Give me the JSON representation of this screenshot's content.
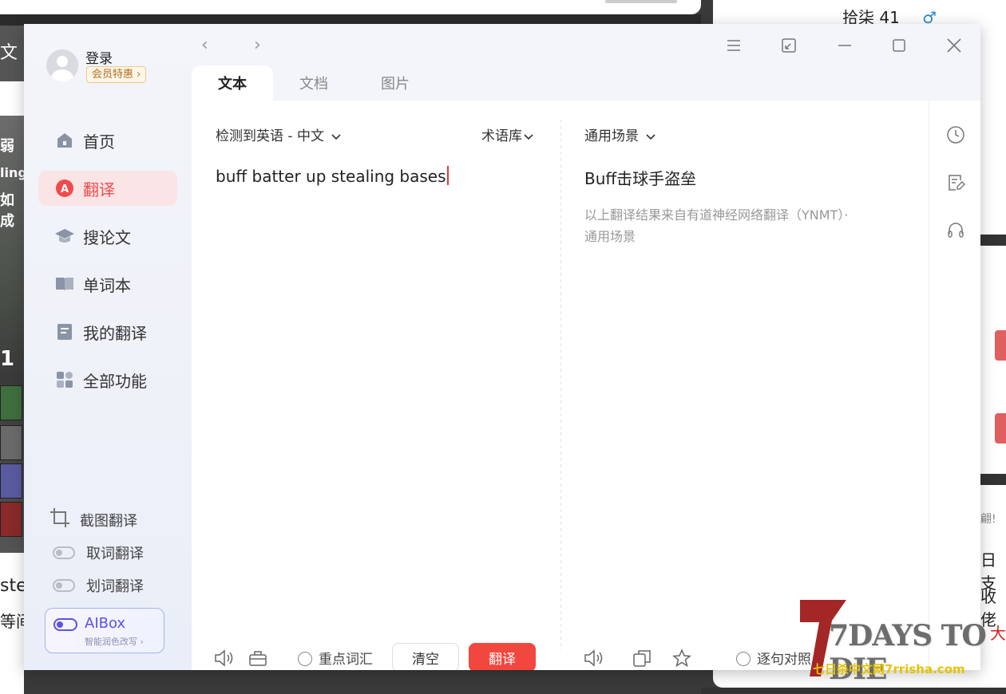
{
  "background": {
    "left_tab_char": "文",
    "left_game_texts": [
      "弱",
      "ling",
      "如成",
      "1"
    ],
    "left_bottom_texts": [
      "ste",
      "等间"
    ],
    "right_user": {
      "name": "拾柒",
      "level": "41",
      "gender_symbol": "♂"
    },
    "right_texts": [
      "日支",
      "收佬",
      "大",
      "翩!"
    ]
  },
  "sidebar": {
    "login_label": "登录",
    "vip_label": "会员特惠",
    "vip_chevron": "›",
    "nav": [
      {
        "label": "首页",
        "icon": "home-icon"
      },
      {
        "label": "翻译",
        "icon": "translate-icon",
        "active": true
      },
      {
        "label": "搜论文",
        "icon": "graduation-cap-icon"
      },
      {
        "label": "单词本",
        "icon": "book-icon"
      },
      {
        "label": "我的翻译",
        "icon": "document-icon"
      },
      {
        "label": "全部功能",
        "icon": "grid-icon"
      }
    ],
    "tools": [
      {
        "label": "截图翻译",
        "icon": "crop-icon"
      },
      {
        "label": "取词翻译",
        "icon": "toggle-icon"
      },
      {
        "label": "划词翻译",
        "icon": "toggle-icon"
      }
    ],
    "aibox": {
      "title": "AIBox",
      "subtitle": "智能润色改写 ›"
    }
  },
  "topbar": {
    "back": "‹",
    "forward": "›",
    "tabs": [
      "文本",
      "文档",
      "图片"
    ],
    "active_tab": "文本"
  },
  "source": {
    "lang_selector": "检测到英语 - 中文",
    "term_library": "术语库",
    "input_text": "buff batter up stealing bases",
    "key_vocab_label": "重点词汇",
    "clear_label": "清空",
    "translate_label": "翻译"
  },
  "target": {
    "scene_selector": "通用场景",
    "result_text": "Buff击球手盗垒",
    "note_line1": "以上翻译结果来自有道神经网络翻译（YNMT）·",
    "note_line2": "通用场景",
    "sentence_compare_label": "逐句对照"
  },
  "watermark": {
    "title": "7DAYS TO DIE",
    "subtitle": "七日杀中文网7rrisha.com"
  },
  "colors": {
    "accent": "#f2473e",
    "aibox": "#5b52e8",
    "active_bg": "#fbe4e6"
  }
}
